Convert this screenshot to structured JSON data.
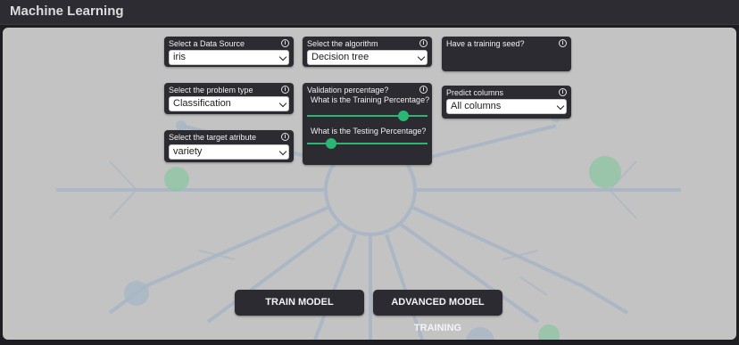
{
  "app": {
    "title": "Machine Learning"
  },
  "data_source": {
    "label": "Select a Data Source",
    "value": "iris"
  },
  "algorithm": {
    "label": "Select the algorithm",
    "value": "Decision tree"
  },
  "seed": {
    "label": "Have a training seed?"
  },
  "problem_type": {
    "label": "Select the problem type",
    "value": "Classification"
  },
  "validation": {
    "label": "Validation percentage?",
    "training_label": "What is the Training Percentage?",
    "testing_label": "What is the Testing Percentage?",
    "training_fraction": 0.8,
    "testing_fraction": 0.2
  },
  "predict_columns": {
    "label": "Predict columns",
    "value": "All columns"
  },
  "target": {
    "label": "Select the target atribute",
    "value": "variety"
  },
  "buttons": {
    "train": "TRAIN MODEL",
    "advanced": "ADVANCED MODEL TRAINING"
  },
  "icons": {
    "info": "info-icon",
    "dropdown": "chevron-down-icon"
  },
  "colors": {
    "accent": "#2bb673",
    "card": "#2c2b31",
    "workspace": "#c3c3c3"
  }
}
